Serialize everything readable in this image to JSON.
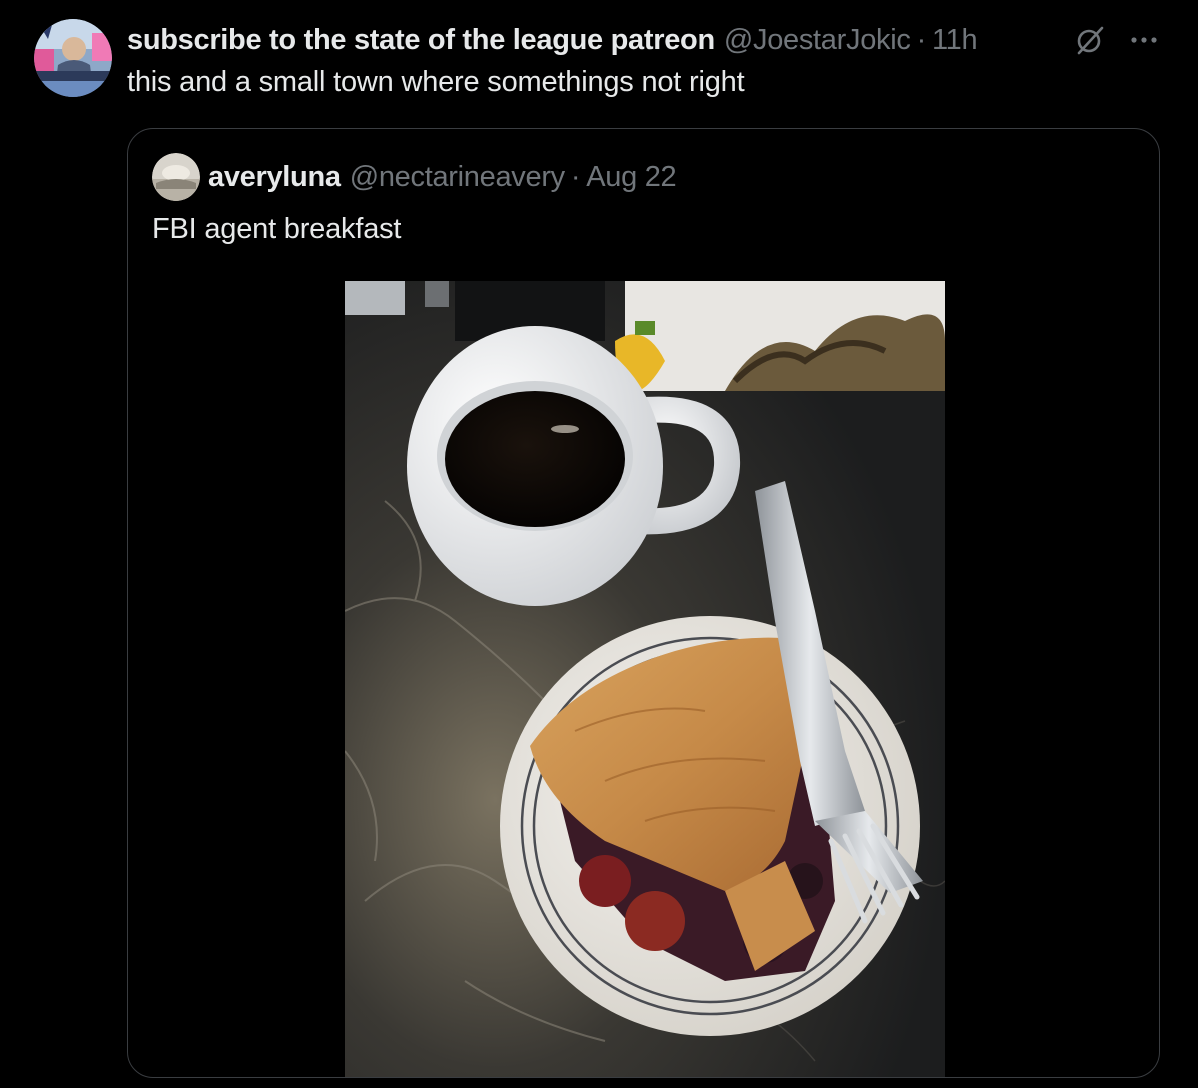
{
  "tweet": {
    "display_name": "subscribe to the state of the league patreon",
    "handle": "@JoestarJokic",
    "separator": "·",
    "time": "11h",
    "text": "this and a small town where somethings not right",
    "avatar_icon": "user-avatar",
    "grok_icon": "grok-slash-icon",
    "more_icon": "more-dots-icon"
  },
  "quote": {
    "display_name": "averyluna",
    "handle": "@nectarineavery",
    "separator": "·",
    "date": "Aug 22",
    "text": "FBI agent breakfast",
    "photo_subject": "coffee-mug-and-pie-slice-photo"
  },
  "colors": {
    "background": "#000000",
    "primary_text": "#e7e9ea",
    "secondary_text": "#71767b",
    "card_border": "#3a3d41"
  }
}
